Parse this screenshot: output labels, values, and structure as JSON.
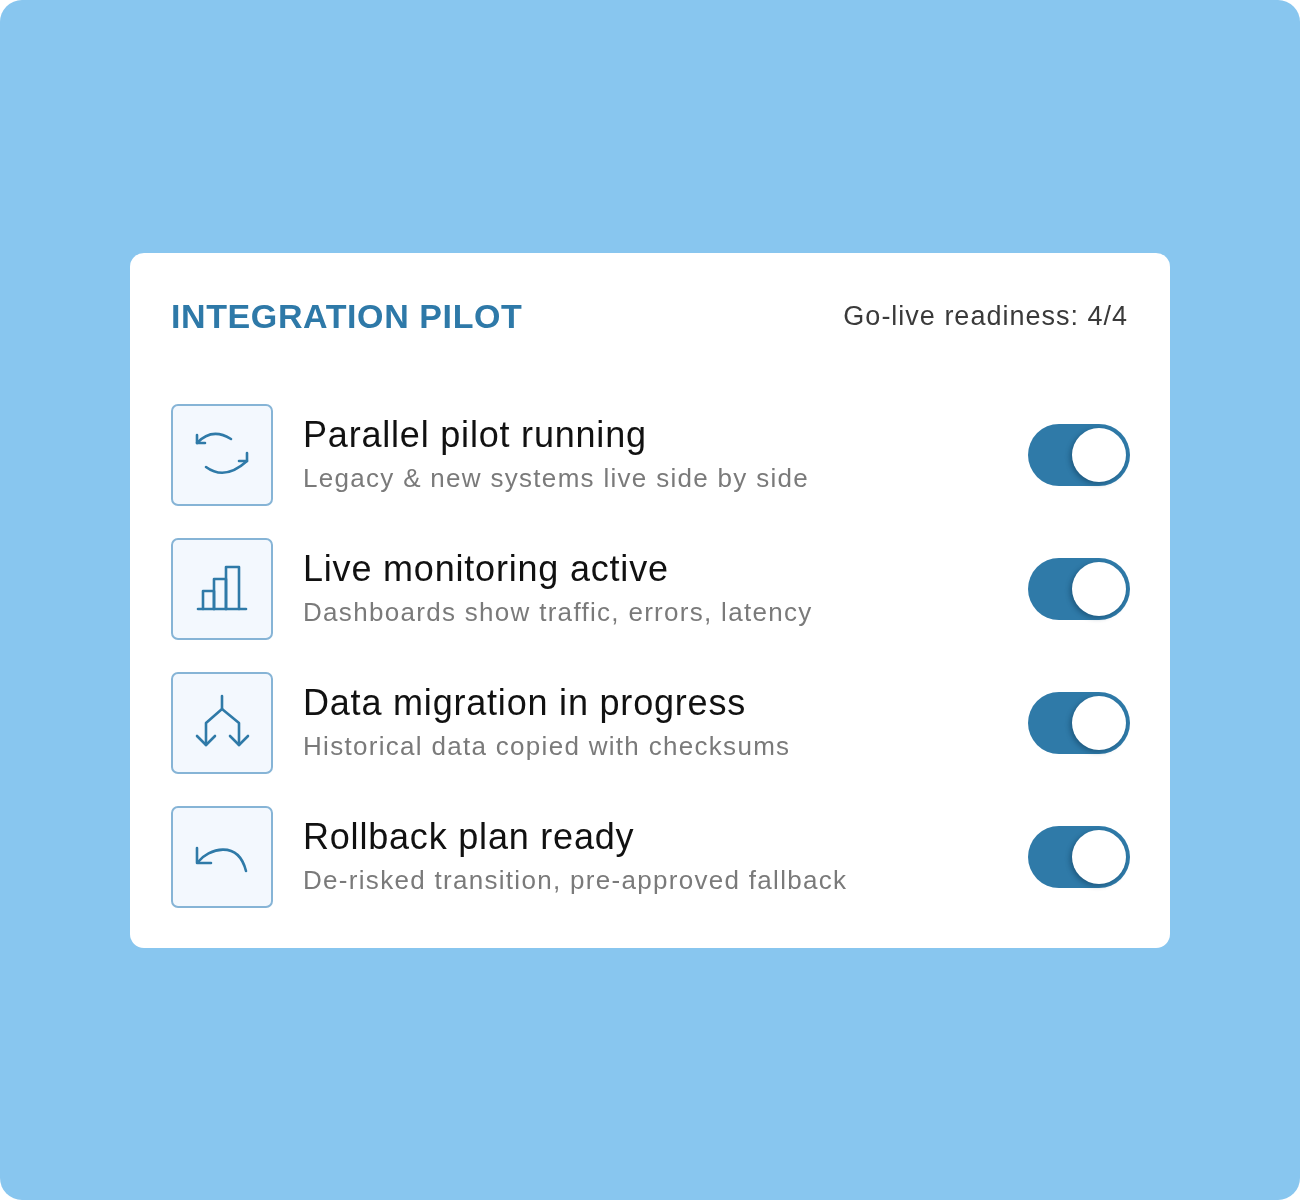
{
  "header": {
    "title": "INTEGRATION PILOT",
    "readiness": "Go-live readiness: 4/4"
  },
  "items": [
    {
      "title": "Parallel pilot running",
      "description": "Legacy & new systems live side by side",
      "on": true
    },
    {
      "title": "Live monitoring active",
      "description": "Dashboards show traffic, errors, latency",
      "on": true
    },
    {
      "title": "Data migration in progress",
      "description": "Historical data copied with checksums",
      "on": true
    },
    {
      "title": "Rollback plan ready",
      "description": "De-risked transition, pre-approved fallback",
      "on": true
    }
  ]
}
